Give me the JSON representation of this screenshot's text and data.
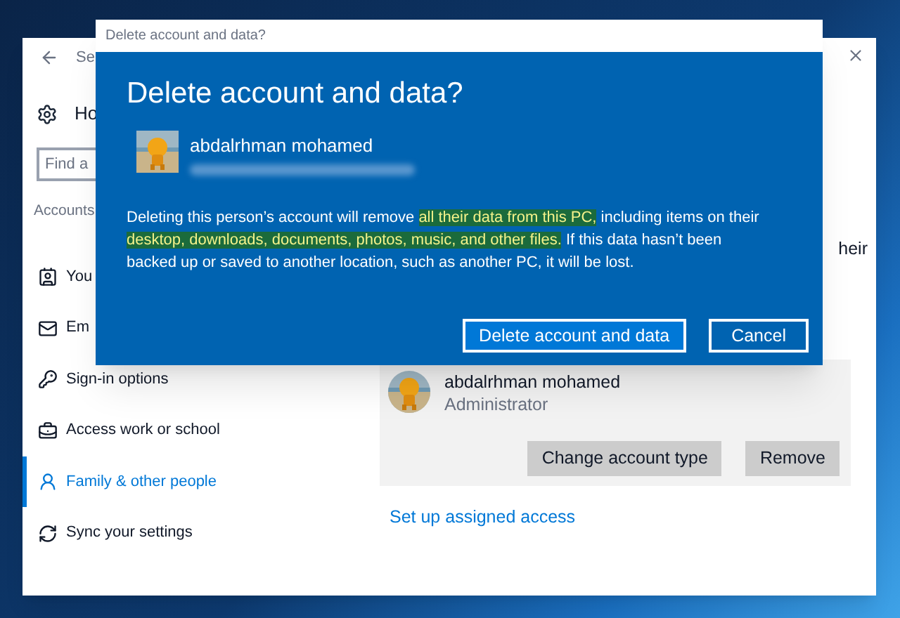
{
  "settings_window": {
    "title": "Se",
    "home": "Ho",
    "search": {
      "placeholder": "Find a"
    },
    "section": "Accounts",
    "sidebar": {
      "items": [
        {
          "label": "You",
          "selected": false
        },
        {
          "label": "Em",
          "selected": false
        },
        {
          "label": "Sign-in options",
          "selected": false
        },
        {
          "label": "Access work or school",
          "selected": false
        },
        {
          "label": "Family & other people",
          "selected": true
        },
        {
          "label": "Sync your settings",
          "selected": false
        }
      ]
    },
    "content_fragment": "heir",
    "account": {
      "name": "abdalrhman mohamed",
      "role": "Administrator",
      "buttons": [
        "Change account type",
        "Remove"
      ]
    },
    "link": "Set up assigned access"
  },
  "dialog": {
    "title": "Delete account and data?",
    "heading": "Delete account and data?",
    "user_name": "abdalrhman mohamed",
    "message": [
      {
        "text": "Deleting this person’s account will remove ",
        "highlighted": false
      },
      {
        "text": "all their data from this PC,",
        "highlighted": true
      },
      {
        "text": " including items on their ",
        "highlighted": false
      },
      {
        "text": "desktop, downloads, documents, photos, music, and other files.",
        "highlighted": true
      },
      {
        "text": " If this data hasn’t been backed up or saved to another location, such as another PC, it will be lost.",
        "highlighted": false
      }
    ],
    "buttons": [
      {
        "label": "Delete account and data",
        "kind": "primary"
      },
      {
        "label": "Cancel",
        "kind": "secondary"
      }
    ]
  }
}
